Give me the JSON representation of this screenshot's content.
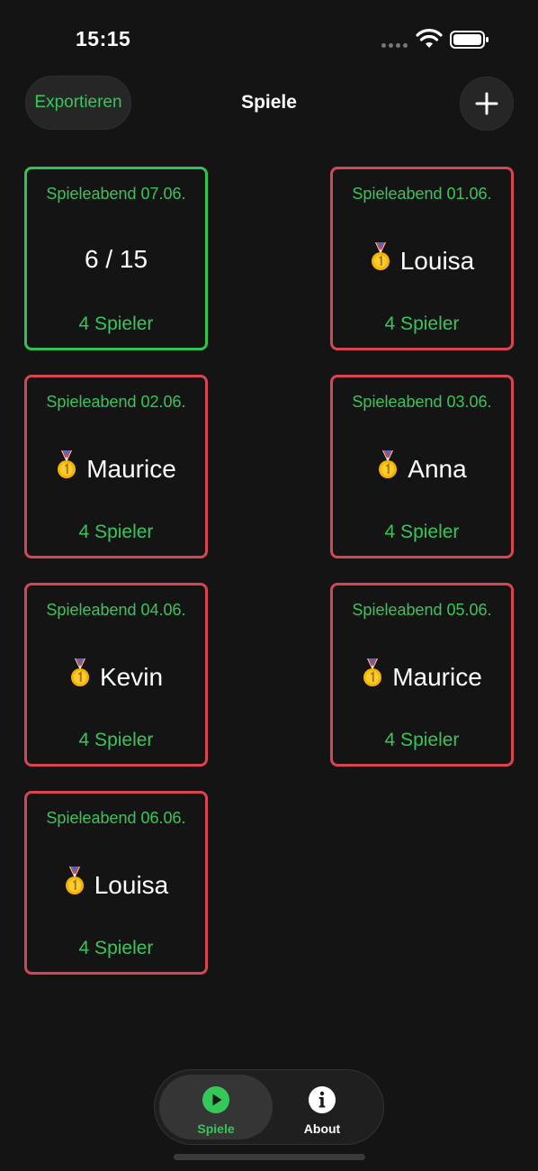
{
  "status_bar": {
    "time": "15:15"
  },
  "nav": {
    "export_label": "Exportieren",
    "title": "Spiele",
    "add_icon": "plus-icon"
  },
  "games": [
    {
      "title": "Spieleabend 07.06.",
      "main": "6 / 15",
      "players": "4 Spieler",
      "state": "in-progress",
      "medal": false
    },
    {
      "title": "Spieleabend 01.06.",
      "main": "Louisa",
      "players": "4 Spieler",
      "state": "finished",
      "medal": true
    },
    {
      "title": "Spieleabend 02.06.",
      "main": "Maurice",
      "players": "4 Spieler",
      "state": "finished",
      "medal": true
    },
    {
      "title": "Spieleabend 03.06.",
      "main": "Anna",
      "players": "4 Spieler",
      "state": "finished",
      "medal": true
    },
    {
      "title": "Spieleabend 04.06.",
      "main": "Kevin",
      "players": "4 Spieler",
      "state": "finished",
      "medal": true
    },
    {
      "title": "Spieleabend 05.06.",
      "main": "Maurice",
      "players": "4 Spieler",
      "state": "finished",
      "medal": true
    },
    {
      "title": "Spieleabend 06.06.",
      "main": "Louisa",
      "players": "4 Spieler",
      "state": "finished",
      "medal": true
    }
  ],
  "tabbar": {
    "tabs": [
      {
        "label": "Spiele",
        "icon": "play-circle-icon",
        "selected": true
      },
      {
        "label": "About",
        "icon": "info-circle-icon",
        "selected": false
      }
    ]
  },
  "colors": {
    "accent": "#34c759",
    "finished_border": "#d64550",
    "active_border": "#30c254",
    "background": "#141414"
  }
}
